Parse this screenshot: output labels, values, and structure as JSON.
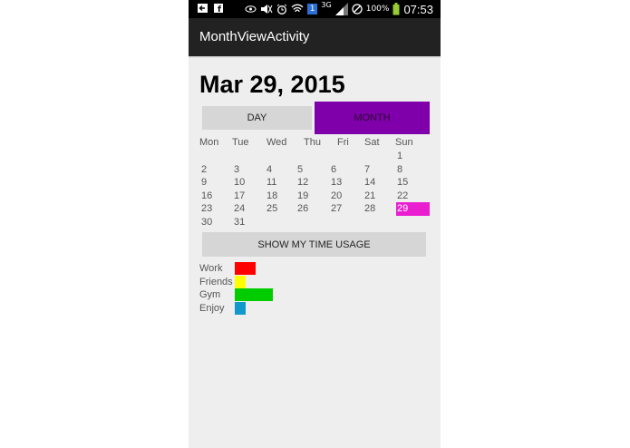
{
  "status_bar": {
    "battery": "100%",
    "time": "07:53",
    "network": "3G",
    "sim": "1",
    "icons": [
      "back-icon",
      "facebook-icon",
      "eye-icon",
      "mute-icon",
      "alarm-icon",
      "wifi-icon",
      "signal-icon",
      "blocked-icon",
      "battery-icon"
    ]
  },
  "action_bar": {
    "title": "MonthViewActivity"
  },
  "date_heading": "Mar 29, 2015",
  "toggle": {
    "day_label": "DAY",
    "month_label": "MONTH",
    "active": "month",
    "active_color": "#7f00aa"
  },
  "calendar": {
    "weekdays": [
      "Mon",
      "Tue",
      "Wed",
      "Thu",
      "Fri",
      "Sat",
      "Sun"
    ],
    "weeks": [
      [
        "",
        "",
        "",
        "",
        "",
        "",
        "1"
      ],
      [
        "2",
        "3",
        "4",
        "5",
        "6",
        "7",
        "8"
      ],
      [
        "9",
        "10",
        "11",
        "12",
        "13",
        "14",
        "15"
      ],
      [
        "16",
        "17",
        "18",
        "19",
        "20",
        "21",
        "22"
      ],
      [
        "23",
        "24",
        "25",
        "26",
        "27",
        "28",
        "29"
      ],
      [
        "30",
        "31",
        "",
        "",
        "",
        "",
        ""
      ]
    ],
    "selected_day": "29",
    "selected_color": "#e91ed0"
  },
  "usage_button_label": "SHOW MY TIME USAGE",
  "usage": [
    {
      "label": "Work",
      "color": "#ff0000",
      "value": 2
    },
    {
      "label": "Friends",
      "color": "#ffff00",
      "value": 1
    },
    {
      "label": "Gym",
      "color": "#00cc00",
      "value": 3.6
    },
    {
      "label": "Enjoy",
      "color": "#1199cc",
      "value": 1
    }
  ]
}
